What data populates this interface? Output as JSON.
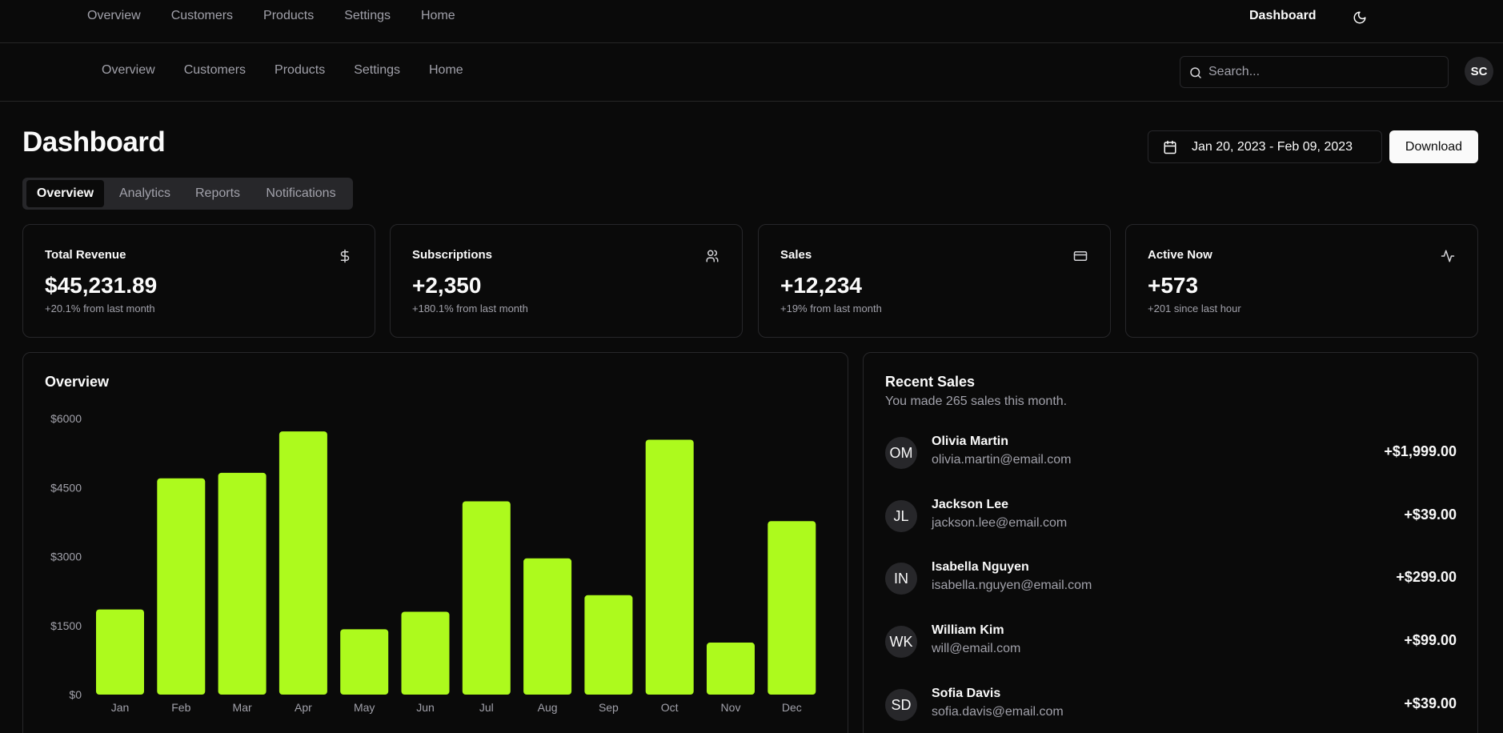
{
  "topbar": {
    "nav": [
      "Overview",
      "Customers",
      "Products",
      "Settings",
      "Home"
    ],
    "brand": "Dashboard",
    "theme_icon": "moon-icon"
  },
  "subbar": {
    "nav": [
      "Overview",
      "Customers",
      "Products",
      "Settings",
      "Home"
    ],
    "search_placeholder": "Search...",
    "avatar_initials": "SC"
  },
  "page": {
    "title": "Dashboard",
    "date_range": "Jan 20, 2023 - Feb 09, 2023",
    "download_label": "Download",
    "tabs": [
      "Overview",
      "Analytics",
      "Reports",
      "Notifications"
    ],
    "active_tab": "Overview"
  },
  "stats": [
    {
      "title": "Total Revenue",
      "value": "$45,231.89",
      "sub": "+20.1% from last month",
      "icon": "dollar-icon"
    },
    {
      "title": "Subscriptions",
      "value": "+2,350",
      "sub": "+180.1% from last month",
      "icon": "users-icon"
    },
    {
      "title": "Sales",
      "value": "+12,234",
      "sub": "+19% from last month",
      "icon": "credit-card-icon"
    },
    {
      "title": "Active Now",
      "value": "+573",
      "sub": "+201 since last hour",
      "icon": "activity-icon"
    }
  ],
  "overview": {
    "title": "Overview"
  },
  "chart_data": {
    "type": "bar",
    "title": "Overview",
    "categories": [
      "Jan",
      "Feb",
      "Mar",
      "Apr",
      "May",
      "Jun",
      "Jul",
      "Aug",
      "Sep",
      "Oct",
      "Nov",
      "Dec"
    ],
    "values": [
      1850,
      4700,
      4820,
      5720,
      1420,
      1800,
      4200,
      2960,
      2160,
      5540,
      1130,
      3770
    ],
    "yticks": [
      "$0",
      "$1500",
      "$3000",
      "$4500",
      "$6000"
    ],
    "ylim": [
      0,
      6000
    ],
    "bar_color": "#adfa1d",
    "grid": false
  },
  "recent_sales": {
    "title": "Recent Sales",
    "subtitle": "You made 265 sales this month.",
    "items": [
      {
        "initials": "OM",
        "name": "Olivia Martin",
        "email": "olivia.martin@email.com",
        "amount": "+$1,999.00"
      },
      {
        "initials": "JL",
        "name": "Jackson Lee",
        "email": "jackson.lee@email.com",
        "amount": "+$39.00"
      },
      {
        "initials": "IN",
        "name": "Isabella Nguyen",
        "email": "isabella.nguyen@email.com",
        "amount": "+$299.00"
      },
      {
        "initials": "WK",
        "name": "William Kim",
        "email": "will@email.com",
        "amount": "+$99.00"
      },
      {
        "initials": "SD",
        "name": "Sofia Davis",
        "email": "sofia.davis@email.com",
        "amount": "+$39.00"
      }
    ]
  }
}
